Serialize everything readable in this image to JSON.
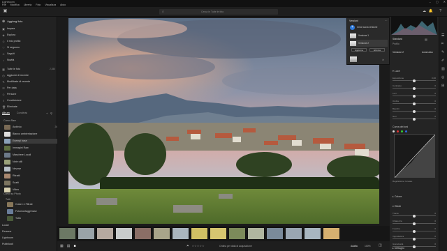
{
  "app": {
    "title": "Lightroom",
    "menu": [
      "File",
      "Modifica",
      "Libreria",
      "Foto",
      "Visualizza",
      "Aiuto"
    ],
    "search_placeholder": "Cerca in Tutte le foto"
  },
  "left_panel": {
    "add_photos": "Aggiungi foto",
    "nav": [
      {
        "icon": "photo-stack-icon",
        "label": "Impara"
      },
      {
        "icon": "compass-icon",
        "label": "Esplora"
      },
      {
        "icon": "person-icon",
        "label": "Il mio profilo"
      },
      {
        "icon": "heart-icon",
        "label": "Si seguono"
      },
      {
        "icon": "person-icon",
        "label": "Seguiti"
      },
      {
        "icon": "bell-icon",
        "label": "Novità"
      }
    ],
    "library": [
      {
        "icon": "grid-icon",
        "label": "Tutte le foto",
        "count": "2,350"
      },
      {
        "icon": "clock-icon",
        "label": "Aggiunte di recente",
        "count": ""
      },
      {
        "icon": "pencil-icon",
        "label": "Modificate di recente",
        "count": ""
      },
      {
        "icon": "user-icon",
        "label": "Per data",
        "count": ""
      },
      {
        "icon": "folder-icon",
        "label": "Persone",
        "count": ""
      },
      {
        "icon": "share-icon",
        "label": "Condivisione",
        "count": ""
      },
      {
        "icon": "trash-icon",
        "label": "Eliminate",
        "count": ""
      }
    ],
    "tabs": [
      "Album",
      "Condivisi"
    ],
    "album_group": "Corso Raw",
    "albums": [
      {
        "label": "Archivio",
        "count": "26",
        "color": "#7a6a55"
      },
      {
        "label": "Bianco ambientazione",
        "count": "",
        "color": "#ddd"
      },
      {
        "label": "Esempi base",
        "count": "",
        "color": "#8aa0b8",
        "selected": true
      },
      {
        "label": "Immagini Raw",
        "count": "",
        "color": "#5f6f42"
      },
      {
        "label": "Maschere Locali",
        "count": "",
        "color": "#6c7a8a"
      },
      {
        "label": "Note utili",
        "count": "",
        "color": "#9aa27a"
      },
      {
        "label": "Nevose",
        "count": "",
        "color": "#b7c0c7"
      },
      {
        "label": "Ritratti",
        "count": "",
        "color": "#a88870"
      },
      {
        "label": "Scatti",
        "count": "",
        "color": "#7d7560"
      },
      {
        "label": "Video",
        "count": "",
        "color": "#d7d0b0"
      }
    ],
    "other_group": "Corso su Photo",
    "other_sub": "Tutti",
    "other_albums": [
      {
        "label": "Colore e Filtrati",
        "color": "#88775a"
      },
      {
        "label": "Fotomontaggi base",
        "color": "#6a7d9a"
      },
      {
        "label": "Tutto",
        "color": "#4a5a3a"
      }
    ],
    "bottom_items": [
      "Locali",
      "Persone",
      "Lightroom",
      "Pubblicati"
    ]
  },
  "versions_popup": {
    "title": "Versioni",
    "create": "Crea nuova versione",
    "items": [
      "Versione 1",
      "Versione 2"
    ],
    "buttons": [
      "Aggiorna",
      "Elimina"
    ]
  },
  "right_panel": {
    "profile_label": "Profilo",
    "profile_value": "Standard",
    "section_versions": "Versione 2",
    "auto": "Automatico",
    "light_section": "Luce",
    "light_sliders": [
      {
        "label": "Esposizione",
        "value": "0,00",
        "pos": 0.5
      },
      {
        "label": "Contrasto",
        "value": "0",
        "pos": 0.5
      },
      {
        "label": "Luci",
        "value": "0",
        "pos": 0.5
      },
      {
        "label": "Ombre",
        "value": "0",
        "pos": 0.5
      },
      {
        "label": "Bianchi",
        "value": "0",
        "pos": 0.5
      },
      {
        "label": "Neri",
        "value": "0",
        "pos": 0.5
      }
    ],
    "curve_label": "Curva dei toni",
    "curve_sub": "Regolazione: Lineare",
    "color_section": "Colore",
    "effects_section": "Effetti",
    "effects_sliders": [
      {
        "label": "Trama",
        "value": "0",
        "pos": 0.5
      },
      {
        "label": "Chiarezza",
        "value": "0",
        "pos": 0.5
      },
      {
        "label": "Foschia",
        "value": "0",
        "pos": 0.5
      },
      {
        "label": "Vignettatura",
        "value": "0",
        "pos": 0.5
      },
      {
        "label": "Granulosità",
        "value": "0",
        "pos": 0.5
      }
    ],
    "detail_section": "Dettaglio",
    "optics_section": "Ottica"
  },
  "bottom_bar": {
    "left_icons": [
      "grid-view-icon",
      "square-grid-icon",
      "detail-view-icon"
    ],
    "sort_label": "Ordina per data di acquisizione",
    "fit": "Adatta",
    "zoom": "100%",
    "rating": "☆☆☆☆☆"
  },
  "filmstrip": [
    "#6c7864",
    "#9aa3a8",
    "#b6a9a0",
    "#c9cccc",
    "#8a6e66",
    "#a8a48a",
    "#aab6be",
    "#d0c064",
    "#d6c670",
    "#7c8a5a",
    "#b0b6a0",
    "#7a8a9a",
    "#9aa6b2",
    "#a8b6c0",
    "#d6b070"
  ]
}
